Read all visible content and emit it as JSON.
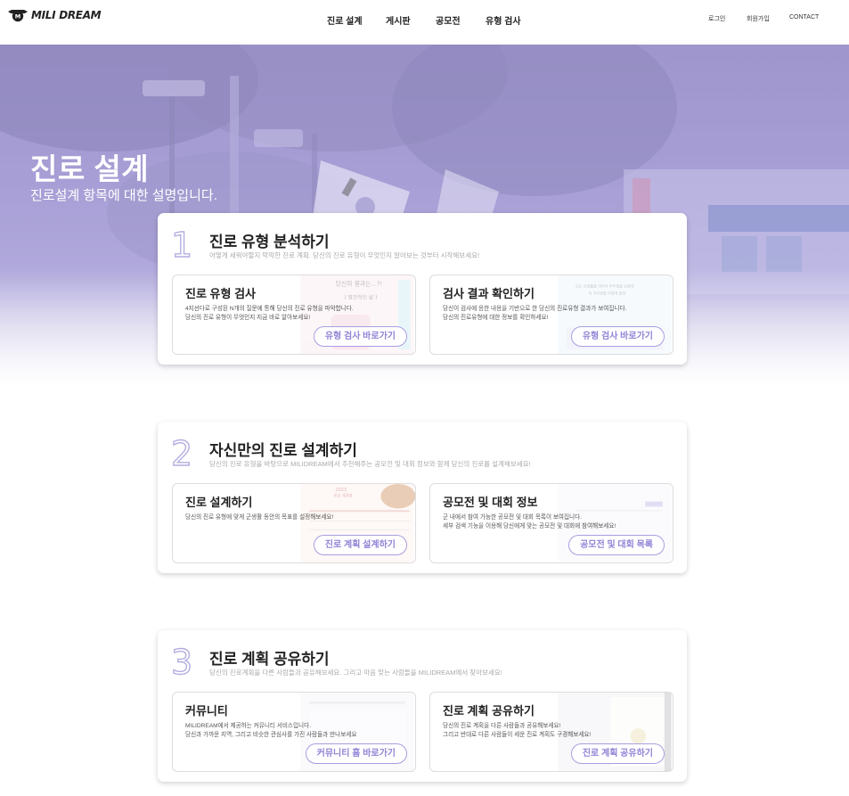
{
  "header": {
    "logo_text": "MILI DREAM",
    "nav": [
      "진로 설계",
      "게시판",
      "공모전",
      "유형 검사"
    ],
    "util": [
      "로그인",
      "회원가입",
      "CONTACT"
    ]
  },
  "hero": {
    "title": "진로 설계",
    "subtitle": "진로설계 항목에 대한 설명입니다."
  },
  "sections": [
    {
      "number": "1",
      "title": "진로 유형 분석하기",
      "description": "어떻게 세워야할지 막막한 진로 계획. 당신의 진로 유형이 무엇인지 알아보는 것부터 시작해보세요!",
      "cards": [
        {
          "title": "진로 유형 검사",
          "desc1": "4지선다로 구성된 N개의 질문에 통해 당신의 진로 유형을 파악합니다.",
          "desc2": "당신의 진로 유형이 무엇인지 지금 바로 알아보세요!",
          "button": "유형 검사 바로가기",
          "preview1": "당신의 결과는...?!",
          "preview2": "( 발전적인 삶 )"
        },
        {
          "title": "검사 결과 확인하기",
          "desc1": "당신이 검사에 응한 내용을 기반으로 한 당신의 진로유형 결과가 보여집니다.",
          "desc2": "당신의 진로유형에 대한 정보를 확인하세요!",
          "button": "유형 검사 바로가기",
          "preview1": "모든 군생활을 의미식 투투형을 보겠대",
          "preview2": "이 자우방을 어떻게 쓸까"
        }
      ]
    },
    {
      "number": "2",
      "title": "자신만의 진로 설계하기",
      "description": "당신의 진로 유형을 바탕으로 MILIDREAM에서 추천해주는 공모전 및 대회 정보와 함께 당신의 진로를 설계해보세요!",
      "cards": [
        {
          "title": "진로 설계하기",
          "desc1": "당신의 진로 유형에 맞게 군생활 동안의 목표를 설정해보세요!",
          "desc2": "",
          "button": "진로 계획 설계하기",
          "preview1": "2023",
          "preview2": "진로 계획표"
        },
        {
          "title": "공모전 및 대회 정보",
          "desc1": "군 내에서 참여 가능한 공모전 및 대회 목록이 보여집니다.",
          "desc2": "세부 검색 기능을 이용해 당신에게 맞는 공모전 및 대회에 참여해보세요!",
          "button": "공모전 및 대회 목록",
          "preview1": "",
          "preview2": ""
        }
      ]
    },
    {
      "number": "3",
      "title": "진로 계획 공유하기",
      "description": "당신의 진로계획을 다른 사람들과 공유해보세요. 그리고 마음 맞는 사람들을 MILIDREAM에서 찾아보세요!",
      "cards": [
        {
          "title": "커뮤니티",
          "desc1": "MILIDREAM에서 제공하는 커뮤니티 서비스입니다.",
          "desc2": "당신과 가까운 지역, 그리고 비슷한 관심사를 가진 사람들과 만나보세요",
          "button": "커뮤니티 홈 바로가기",
          "preview1": "",
          "preview2": ""
        },
        {
          "title": "진로 계획 공유하기",
          "desc1": "당신의 진로 계획을 다른 사람들과 공유해보세요!",
          "desc2": "그리고 반대로 다른 사람들이 세운 진로 계획도 구경해보세요!",
          "button": "진로 계획 공유하기",
          "preview1": "",
          "preview2": ""
        }
      ]
    }
  ],
  "colors": {
    "accent": "#a89ee0",
    "accent_text": "#8f84d6",
    "hero_tint": "#a79fd6"
  }
}
